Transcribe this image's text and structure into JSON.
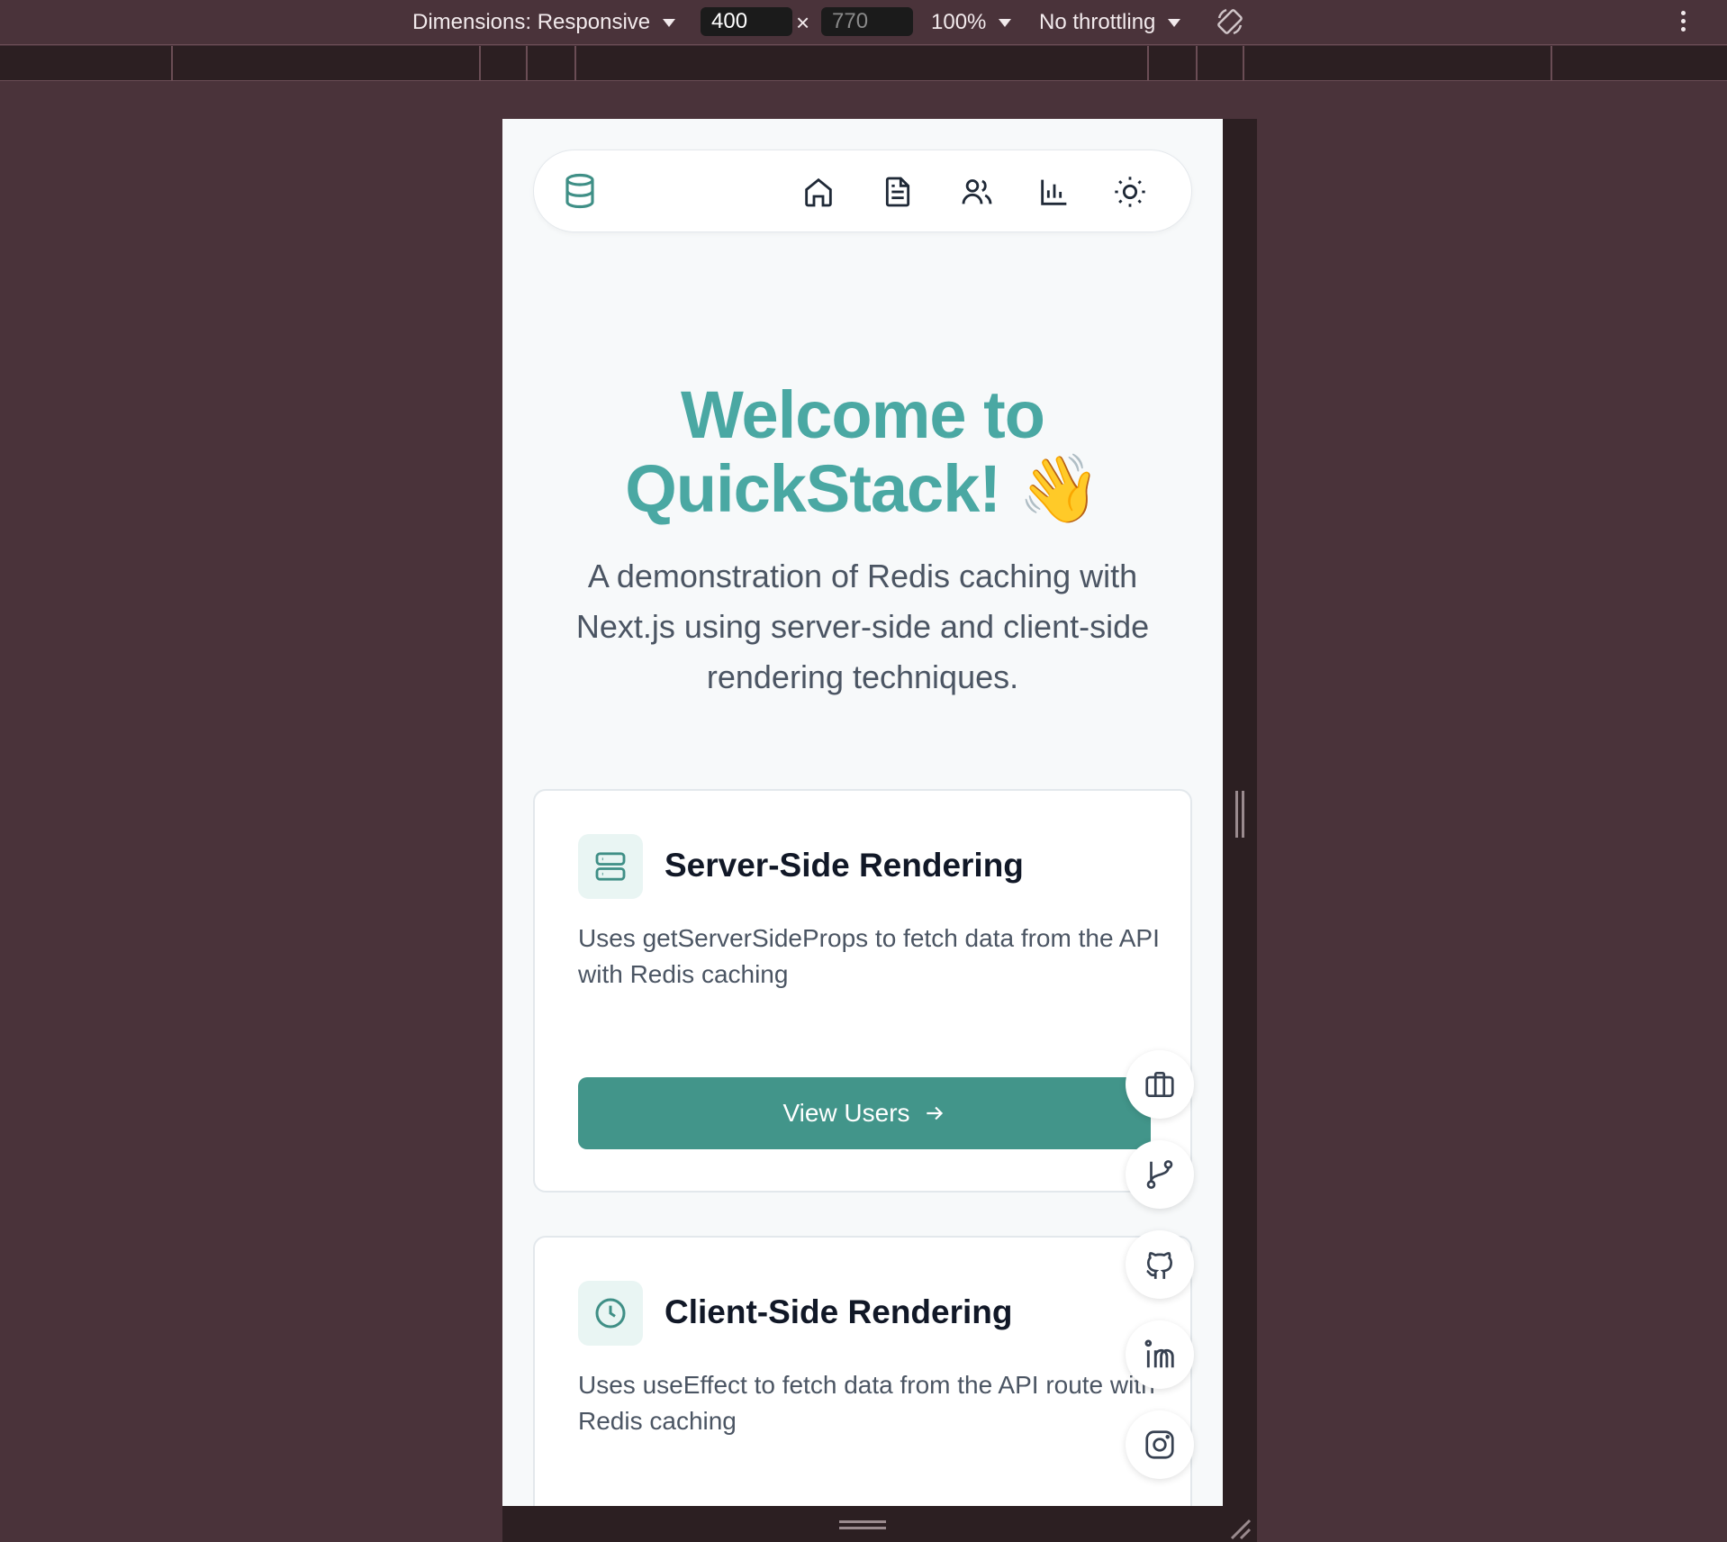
{
  "devtools": {
    "dimensions_label": "Dimensions: Responsive",
    "width": "400",
    "height": "770",
    "times": "×",
    "zoom": "100%",
    "throttling": "No throttling"
  },
  "navbar": {
    "icons": [
      "database-icon",
      "home-icon",
      "document-icon",
      "users-icon",
      "bar-chart-icon",
      "sun-icon"
    ]
  },
  "hero": {
    "title_line1": "Welcome to",
    "title_line2": "QuickStack! 👋",
    "subtitle": "A demonstration of Redis caching with Next.js using server-side and client-side rendering techniques."
  },
  "cards": [
    {
      "icon": "server-icon",
      "title": "Server-Side Rendering",
      "description": "Uses getServerSideProps to fetch data from the API with Redis caching",
      "cta": "View Users"
    },
    {
      "icon": "clock-icon",
      "title": "Client-Side Rendering",
      "description": "Uses useEffect to fetch data from the API route with Redis caching"
    }
  ],
  "floating": [
    "briefcase-icon",
    "git-branch-icon",
    "github-icon",
    "linkedin-icon",
    "instagram-icon"
  ],
  "colors": {
    "accent": "#4aa8a3",
    "button": "#42958a",
    "frame": "#4a333a"
  }
}
